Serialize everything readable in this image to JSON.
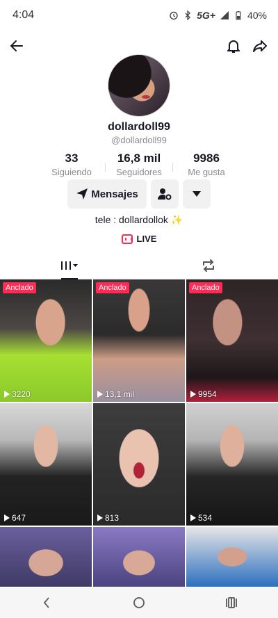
{
  "status_bar": {
    "time": "4:04",
    "network": "5G+",
    "battery": "40%"
  },
  "profile": {
    "username": "dollardoll99",
    "handle": "@dollardoll99",
    "bio": "tele : dollardollok ✨",
    "live_label": "LIVE"
  },
  "stats": [
    {
      "value": "33",
      "label": "Siguiendo"
    },
    {
      "value": "16,8 mil",
      "label": "Seguidores"
    },
    {
      "value": "9986",
      "label": "Me gusta"
    }
  ],
  "actions": {
    "message_label": "Mensajes"
  },
  "videos": [
    {
      "pinned": true,
      "badge": "Anclado",
      "views": "3220"
    },
    {
      "pinned": true,
      "badge": "Anclado",
      "views": "13,1 mil"
    },
    {
      "pinned": true,
      "badge": "Anclado",
      "views": "9954"
    },
    {
      "pinned": false,
      "badge": "",
      "views": "647"
    },
    {
      "pinned": false,
      "badge": "",
      "views": "813"
    },
    {
      "pinned": false,
      "badge": "",
      "views": "534"
    },
    {
      "pinned": false,
      "badge": "",
      "views": ""
    },
    {
      "pinned": false,
      "badge": "",
      "views": ""
    },
    {
      "pinned": false,
      "badge": "",
      "views": ""
    }
  ],
  "colors": {
    "accent": "#fe2c55",
    "text": "#161823",
    "muted": "#8a8b91"
  }
}
